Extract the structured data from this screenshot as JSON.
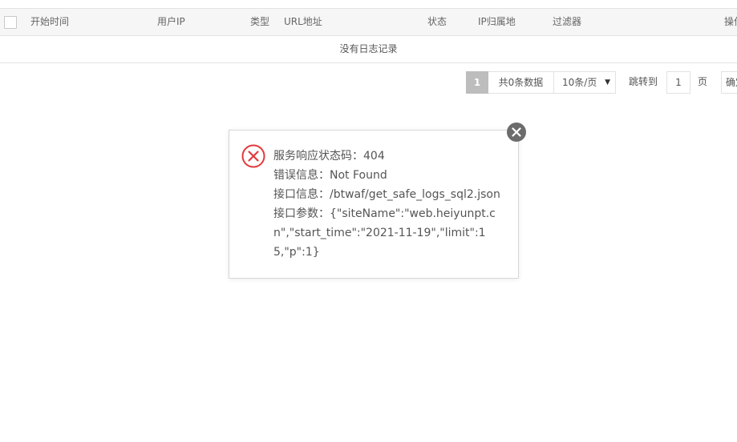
{
  "table": {
    "columns": [
      "开始时间",
      "用户IP",
      "类型",
      "URL地址",
      "状态",
      "IP归属地",
      "过滤器",
      "操作"
    ],
    "empty_text": "没有日志记录"
  },
  "pager": {
    "current_page": "1",
    "total_text": "共0条数据",
    "page_size": "10条/页",
    "jump_label": "跳转到",
    "jump_value": "1",
    "page_label": "页",
    "confirm_label": "确定"
  },
  "error_dialog": {
    "status_line": "服务响应状态码：404",
    "error_line": "错误信息：Not Found",
    "api_line": "接口信息：/btwaf/get_safe_logs_sql2.json",
    "params_line": "接口参数：{\"siteName\":\"web.heiyunpt.cn\",\"start_time\":\"2021-11-19\",\"limit\":15,\"p\":1}",
    "icon": "error-circle-x-icon",
    "close_icon": "close-icon"
  },
  "colors": {
    "error_red": "#e4393c",
    "header_bg": "#f6f6f6",
    "pager_active": "#bdbdbd",
    "close_bg": "#6c6c6c"
  }
}
